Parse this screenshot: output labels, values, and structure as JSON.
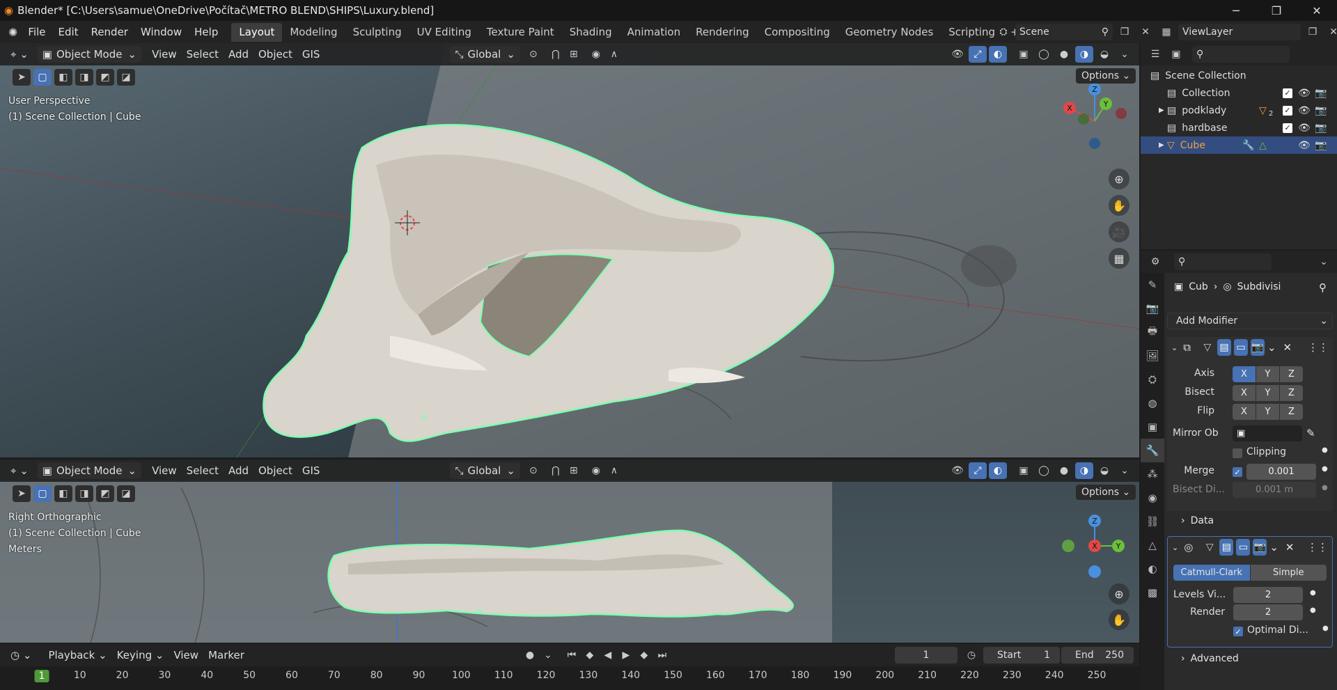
{
  "window": {
    "title": "Blender* [C:\\Users\\samue\\OneDrive\\Počítač\\METRO BLEND\\SHIPS\\Luxury.blend]"
  },
  "menu": [
    "File",
    "Edit",
    "Render",
    "Window",
    "Help"
  ],
  "workspaces": [
    "Layout",
    "Modeling",
    "Sculpting",
    "UV Editing",
    "Texture Paint",
    "Shading",
    "Animation",
    "Rendering",
    "Compositing",
    "Geometry Nodes",
    "Scripting"
  ],
  "scene": {
    "name": "Scene",
    "view_layer": "ViewLayer"
  },
  "viewport_top": {
    "mode": "Object Mode",
    "menus": [
      "View",
      "Select",
      "Add",
      "Object",
      "GIS"
    ],
    "transform": "Global",
    "options": "Options",
    "view_name": "User Perspective",
    "collection_info": "(1) Scene Collection | Cube",
    "gizmo": {
      "z": "Z",
      "y": "Y",
      "x": "X"
    }
  },
  "viewport_bottom": {
    "mode": "Object Mode",
    "menus": [
      "View",
      "Select",
      "Add",
      "Object",
      "GIS"
    ],
    "transform": "Global",
    "options": "Options",
    "view_name": "Right Orthographic",
    "collection_info": "(1) Scene Collection | Cube",
    "units": "Meters",
    "gizmo": {
      "z": "Z",
      "y": "Y",
      "x": "X"
    }
  },
  "outliner": {
    "root": "Scene Collection",
    "items": [
      {
        "name": "Collection"
      },
      {
        "name": "podklady",
        "badge": "2"
      },
      {
        "name": "hardbase"
      },
      {
        "name": "Cube"
      }
    ]
  },
  "properties": {
    "breadcrumb_object": "Cub",
    "breadcrumb_modifier": "Subdivisi",
    "add_modifier": "Add Modifier",
    "mirror": {
      "axis_label": "Axis",
      "bisect_label": "Bisect",
      "flip_label": "Flip",
      "axes": [
        "X",
        "Y",
        "Z"
      ],
      "mirror_object_label": "Mirror Ob",
      "clipping_label": "Clipping",
      "merge_label": "Merge",
      "merge_value": "0.001",
      "bisect_distance_label": "Bisect Di...",
      "bisect_distance_value": "0.001 m",
      "data_label": "Data"
    },
    "subdivision": {
      "type_a": "Catmull-Clark",
      "type_b": "Simple",
      "levels_label": "Levels Vi...",
      "levels_value": "2",
      "render_label": "Render",
      "render_value": "2",
      "optimal_label": "Optimal Di...",
      "advanced_label": "Advanced"
    }
  },
  "timeline": {
    "menus": [
      "Playback",
      "Keying",
      "View",
      "Marker"
    ],
    "current_frame": "1",
    "start_label": "Start",
    "start_value": "1",
    "end_label": "End",
    "end_value": "250",
    "ruler": [
      "1",
      "10",
      "20",
      "30",
      "40",
      "50",
      "60",
      "70",
      "80",
      "90",
      "100",
      "110",
      "120",
      "130",
      "140",
      "150",
      "160",
      "170",
      "180",
      "190",
      "200",
      "210",
      "220",
      "230",
      "240",
      "250"
    ]
  },
  "colors": {
    "accent": "#4772b3",
    "selection_outline": "#7dffb0",
    "hull": "#d9d4cc"
  }
}
